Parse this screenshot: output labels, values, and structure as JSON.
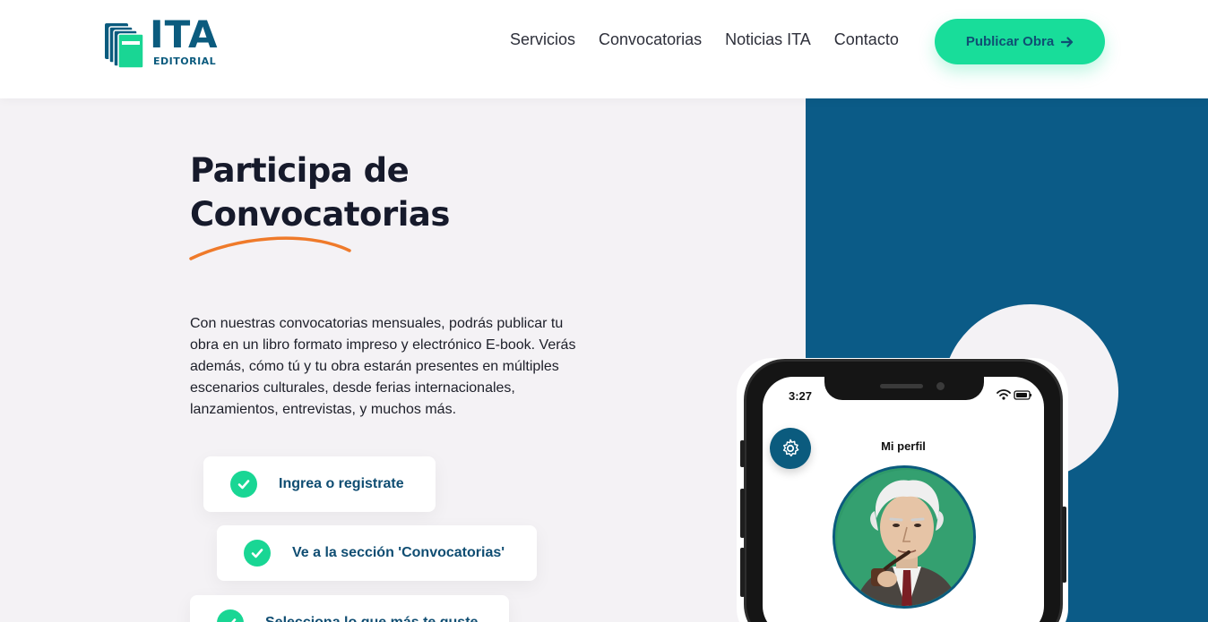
{
  "header": {
    "logo": {
      "text": "ITA",
      "subtext": "EDITORIAL"
    },
    "nav": [
      "Servicios",
      "Convocatorias",
      "Noticias ITA",
      "Contacto"
    ],
    "cta_label": "Publicar Obra"
  },
  "hero": {
    "title_line1": "Participa de",
    "title_line2": "Convocatorias",
    "description": "Con nuestras convocatorias mensuales, podrás publicar tu obra en un libro formato impreso y electrónico E-book. Verás además, cómo tú y tu obra estarán presentes en múltiples escenarios culturales, desde ferias internacionales, lanzamientos, entrevistas, y muchos más.",
    "steps": [
      "Ingrea o registrate",
      "Ve a la sección 'Convocatorias'",
      "Selecciona lo que más te guste"
    ]
  },
  "phone": {
    "time": "3:27",
    "screen_title": "Mi perfil"
  },
  "colors": {
    "brand_blue": "#0b5b87",
    "accent_green": "#18dd9a",
    "swoosh_orange": "#ef7a2a",
    "page_bg": "#f4f2f5"
  },
  "icons": [
    "books-logo-icon",
    "arrow-right-icon",
    "check-icon",
    "gear-icon",
    "wifi-icon",
    "battery-icon"
  ]
}
